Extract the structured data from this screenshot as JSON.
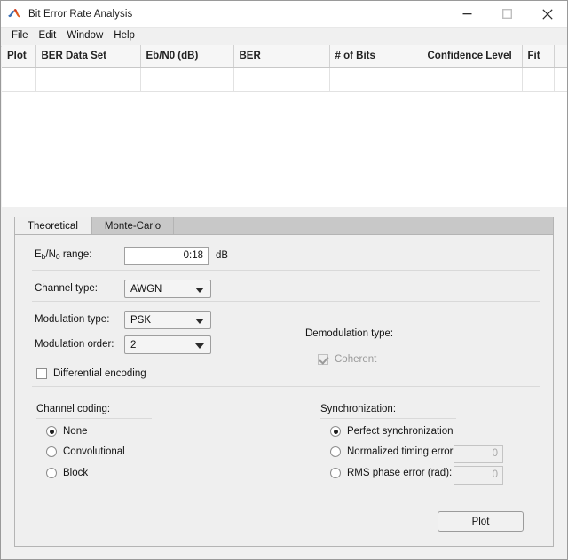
{
  "window": {
    "title": "Bit Error Rate Analysis",
    "logo_icon": "matlab-membrane-icon",
    "minimize_icon": "minimize-icon",
    "maximize_icon": "maximize-icon",
    "close_icon": "close-icon"
  },
  "menubar": {
    "items": [
      {
        "label": "File"
      },
      {
        "label": "Edit"
      },
      {
        "label": "Window"
      },
      {
        "label": "Help"
      }
    ]
  },
  "results_table": {
    "columns": [
      {
        "label": "Plot"
      },
      {
        "label": "BER Data Set"
      },
      {
        "label": "Eb/N0 (dB)"
      },
      {
        "label": "BER"
      },
      {
        "label": "# of Bits"
      },
      {
        "label": "Confidence Level"
      },
      {
        "label": "Fit"
      }
    ],
    "rows": []
  },
  "tabs": [
    {
      "label": "Theoretical",
      "active": true
    },
    {
      "label": "Monte-Carlo",
      "active": false
    }
  ],
  "theoretical": {
    "ebno_range": {
      "label_main": "E",
      "label_sub1": "b",
      "label_mid": "/N",
      "label_sub2": "0",
      "label_end": " range:",
      "value": "0:18",
      "unit": "dB"
    },
    "channel_type": {
      "label": "Channel type:",
      "value": "AWGN"
    },
    "modulation_type": {
      "label": "Modulation type:",
      "value": "PSK"
    },
    "modulation_order": {
      "label": "Modulation order:",
      "value": "2"
    },
    "differential_encoding": {
      "label": "Differential encoding",
      "checked": false
    },
    "demodulation": {
      "label": "Demodulation type:",
      "coherent_label": "Coherent",
      "coherent_checked": true,
      "coherent_enabled": false
    },
    "channel_coding": {
      "label": "Channel coding:",
      "options": [
        {
          "label": "None",
          "selected": true
        },
        {
          "label": "Convolutional",
          "selected": false
        },
        {
          "label": "Block",
          "selected": false
        }
      ]
    },
    "synchronization": {
      "label": "Synchronization:",
      "options": [
        {
          "label": "Perfect synchronization",
          "selected": true
        },
        {
          "label": "Normalized timing error:",
          "selected": false,
          "value": "0",
          "enabled": false
        },
        {
          "label": "RMS phase error (rad):",
          "selected": false,
          "value": "0",
          "enabled": false
        }
      ]
    },
    "plot_button": {
      "label": "Plot"
    }
  },
  "colors": {
    "window_bg": "#f0f0f0",
    "panel_bg": "#efefef",
    "tab_inactive": "#c8c8c8",
    "table_header": "#f6f6f6",
    "logo_blue": "#2c5fa8",
    "logo_orange": "#e8762c",
    "logo_red": "#c8372d"
  }
}
